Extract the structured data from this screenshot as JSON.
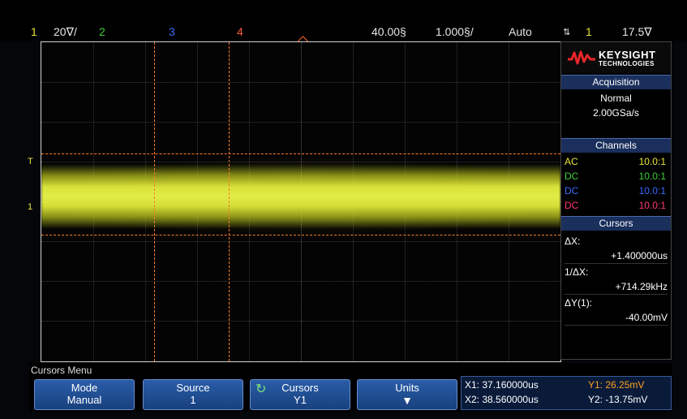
{
  "top": {
    "ch1_num": "1",
    "ch1_scale": "20∇/",
    "ch2_num": "2",
    "ch3_num": "3",
    "ch4_num": "4",
    "time_delay": "40.00§",
    "time_scale": "1.000§/",
    "trigger_mode": "Auto",
    "trigger_source": "1",
    "trigger_level": "17.5∇"
  },
  "screen": {
    "marker_T": "T",
    "marker_1": "1"
  },
  "panel": {
    "brand_line1": "KEYSIGHT",
    "brand_line2": "TECHNOLOGIES",
    "acquisition": {
      "title": "Acquisition",
      "mode": "Normal",
      "rate": "2.00GSa/s"
    },
    "channels": {
      "title": "Channels",
      "rows": [
        {
          "coupling": "AC",
          "probe": "10.0:1",
          "color": "#e6e63a"
        },
        {
          "coupling": "DC",
          "probe": "10.0:1",
          "color": "#3ccf3c"
        },
        {
          "coupling": "DC",
          "probe": "10.0:1",
          "color": "#3a6cff"
        },
        {
          "coupling": "DC",
          "probe": "10.0:1",
          "color": "#ff3a6a"
        }
      ]
    },
    "cursors": {
      "title": "Cursors",
      "dx_label": "ΔX:",
      "dx_value": "+1.400000us",
      "inv_label": "1/ΔX:",
      "inv_value": "+714.29kHz",
      "dy_label": "ΔY(1):",
      "dy_value": "-40.00mV"
    }
  },
  "menu": {
    "title": "Cursors Menu",
    "mode": {
      "label": "Mode",
      "value": "Manual"
    },
    "source": {
      "label": "Source",
      "value": "1"
    },
    "cursors": {
      "label": "Cursors",
      "value": "Y1"
    },
    "units": {
      "label": "Units"
    },
    "readout": {
      "x1": "X1: 37.160000us",
      "x2": "X2: 38.560000us",
      "y1": "Y1: 26.25mV",
      "y2": "Y2: -13.75mV"
    }
  },
  "colors": {
    "ch1": "#e6e63a",
    "ch2": "#3ccf3c",
    "ch3": "#3a6cff",
    "ch4": "#ff3a6a",
    "cursor": "#ff7a2a",
    "softkey": "#1f4e94"
  }
}
